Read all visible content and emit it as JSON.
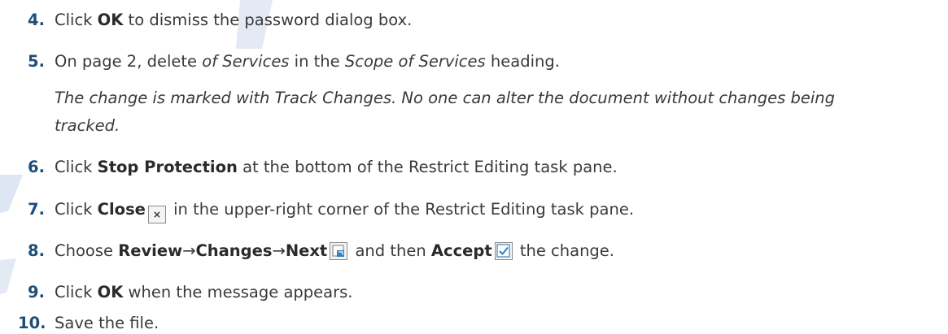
{
  "steps": [
    {
      "num": "4.",
      "t1": "Click ",
      "b1": "OK",
      "t2": " to dismiss the password dialog box."
    },
    {
      "num": "5.",
      "t1": "On page 2, delete ",
      "i1": "of Services",
      "t2": " in the ",
      "i2": "Scope of Services",
      "t3": " heading."
    },
    {
      "num": "6.",
      "t1": "Click ",
      "b1": "Stop Protection",
      "t2": " at the bottom of the Restrict Editing task pane."
    },
    {
      "num": "7.",
      "t1": "Click ",
      "b1": "Close",
      "t2": " in the upper-right corner of the Restrict Editing task pane."
    },
    {
      "num": "8.",
      "t1": "Choose ",
      "b1": "Review",
      "arrow1": "→",
      "b2": "Changes",
      "arrow2": "→",
      "b3": "Next",
      "t2": " and then ",
      "b4": "Accept",
      "t3": " the change."
    },
    {
      "num": "9.",
      "t1": "Click ",
      "b1": "OK",
      "t2": " when the message appears."
    },
    {
      "num": "10.",
      "t1": "Save the file."
    }
  ],
  "note": {
    "line1": "The change is marked with Track Changes. No one can alter the document without changes being",
    "line2": "tracked."
  },
  "icons": {
    "close": "close-icon",
    "next": "next-change-icon",
    "accept": "accept-change-icon",
    "close_glyph": "×"
  },
  "colors": {
    "step_number": "#1f4e79",
    "watermark": "#dde6f2"
  }
}
